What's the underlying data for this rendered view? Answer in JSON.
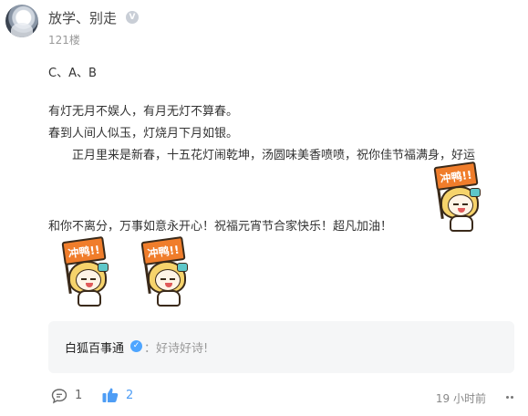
{
  "post": {
    "username": "放学、别走",
    "floor": "121楼",
    "lines": [
      "C、A、B",
      "有灯无月不娱人，有月无灯不算春。",
      "春到人间人似玉，灯烧月下月如银。",
      "正月里来是新春，十五花灯闹乾坤，汤圆味美香喷喷，祝你佳节福满身，好运",
      "和你不离分，万事如意永开心！祝福元宵节合家快乐！超凡加油！"
    ],
    "sticker_text": "冲鸭!!"
  },
  "reply": {
    "username": "白狐百事通",
    "text": "：好诗好诗!"
  },
  "footer": {
    "comment_count": "1",
    "like_count": "2",
    "time": "19 小时前"
  },
  "colors": {
    "accent_blue": "#4e9df5",
    "sticker_orange": "#f07d2b"
  }
}
